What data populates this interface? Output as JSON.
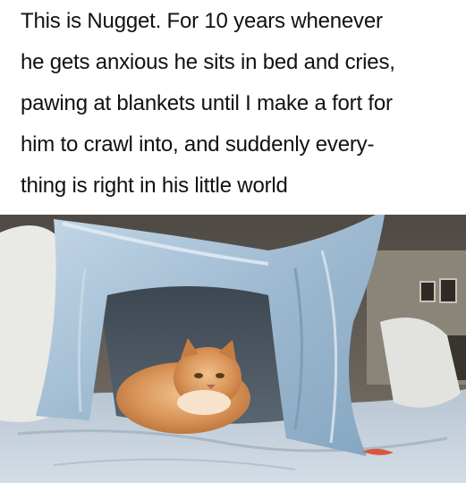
{
  "caption": {
    "lines": [
      "This is Nugget. For 10 years whenever",
      "he gets anxious he sits in bed and cries,",
      "pawing at blankets until I make a fort for",
      "him to crawl into, and suddenly every-",
      "thing is right in his little world"
    ]
  },
  "photo": {
    "subject": "orange long-haired cat inside a blanket fort on a bed",
    "colors": {
      "blanket": "#a9c3d8",
      "bedsheet": "#c9d3de",
      "pillow": "#e8e8e6",
      "cat_fur": "#d9955a",
      "room_wall": "#6f6a63"
    }
  }
}
